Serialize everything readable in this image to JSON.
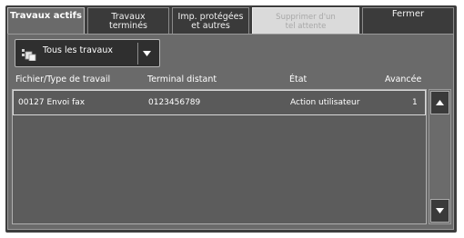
{
  "tabs": [
    {
      "label": "Travaux actifs",
      "active": true,
      "enabled": true
    },
    {
      "label": "Travaux\nterminés",
      "active": false,
      "enabled": true
    },
    {
      "label": "Imp. protégées\net autres",
      "active": false,
      "enabled": true
    },
    {
      "label": "Supprimer d'un\ntel attente",
      "active": false,
      "enabled": false
    },
    {
      "label": "Fermer",
      "active": false,
      "enabled": true
    }
  ],
  "filter": {
    "selected": "Tous les travaux",
    "icon": "jobs-filter-icon"
  },
  "columns": [
    "Fichier/Type de travail",
    "Terminal distant",
    "État",
    "Avancée"
  ],
  "rows": [
    {
      "file": "00127  Envoi fax",
      "terminal": "0123456789",
      "state": "Action utilisateur",
      "progress": "1"
    }
  ],
  "colors": {
    "frame": "#3d3d3d",
    "panel": "#6a6a6a",
    "text": "#ffffff",
    "disabled_tab": "#dadada"
  }
}
